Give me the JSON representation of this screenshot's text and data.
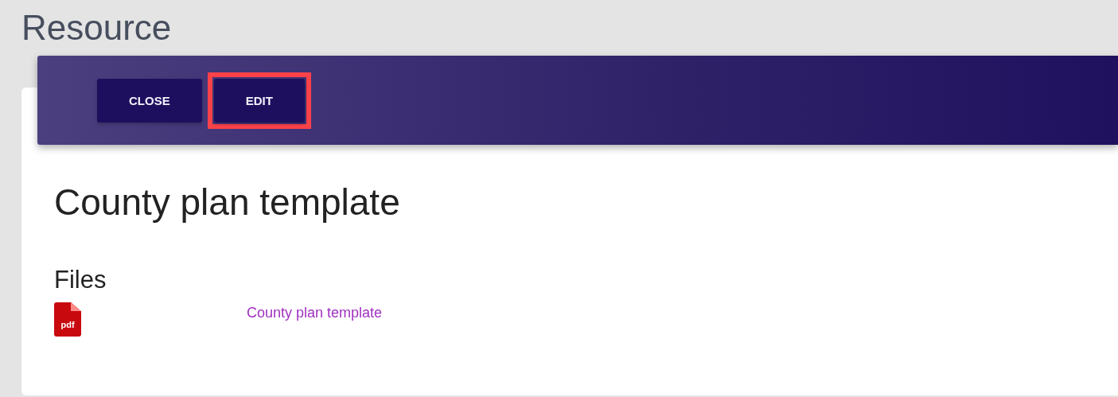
{
  "page_title": "Resource",
  "toolbar": {
    "buttons": [
      {
        "label": "CLOSE",
        "highlighted": false
      },
      {
        "label": "EDIT",
        "highlighted": true
      }
    ]
  },
  "resource": {
    "title": "County plan template",
    "files_heading": "Files",
    "files": [
      {
        "icon_label": "pdf",
        "name": "County plan template"
      }
    ]
  }
}
